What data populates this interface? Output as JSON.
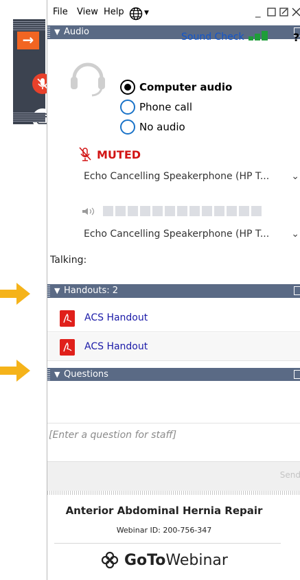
{
  "menubar": {
    "file": "File",
    "view": "View",
    "help": "Help"
  },
  "sections": {
    "audio": "Audio",
    "handouts": "Handouts: 2",
    "questions": "Questions"
  },
  "audio": {
    "sound_check": "Sound Check",
    "help_mark": "?",
    "options": [
      "Computer audio",
      "Phone call",
      "No audio"
    ],
    "selected": "Computer audio",
    "muted_label": "MUTED",
    "microphone_device": "Echo Cancelling Speakerphone (HP T...",
    "speaker_device": "Echo Cancelling Speakerphone (HP T...",
    "talking_label": "Talking:"
  },
  "handouts": [
    {
      "name": "ACS Handout"
    },
    {
      "name": "ACS Handout"
    }
  ],
  "questions": {
    "placeholder": "[Enter a question for staff]",
    "send_label": "Send"
  },
  "footer": {
    "webinar_title": "Anterior Abdominal Hernia Repair",
    "webinar_id": "Webinar ID: 200-756-347",
    "logo_bold": "GoTo",
    "logo_thin": "Webinar"
  },
  "colors": {
    "section_bar": "#5a6a85",
    "accent_orange": "#f26522",
    "muted_red": "#d21414",
    "link_blue": "#1155cc",
    "pdf_red": "#e0201b"
  }
}
